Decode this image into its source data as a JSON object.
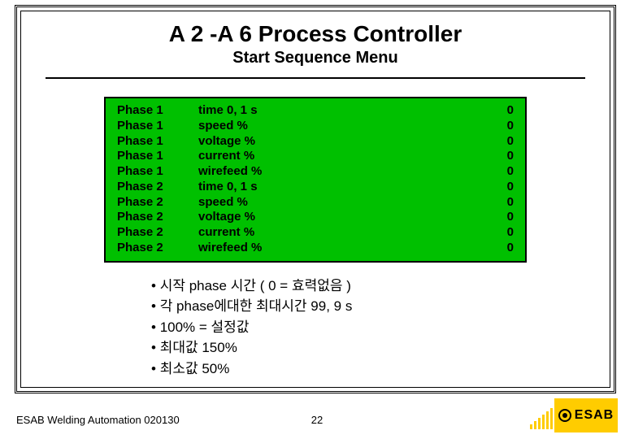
{
  "title": "A 2 -A 6 Process Controller",
  "subtitle": "Start Sequence Menu",
  "panel": {
    "rows": [
      {
        "phase": "Phase 1",
        "param": "time   0, 1 s",
        "value": "0"
      },
      {
        "phase": "Phase 1",
        "param": "speed  %",
        "value": "0"
      },
      {
        "phase": "Phase 1",
        "param": "voltage %",
        "value": "0"
      },
      {
        "phase": "Phase 1",
        "param": "current   %",
        "value": "0"
      },
      {
        "phase": "Phase 1",
        "param": "wirefeed  %",
        "value": "0"
      },
      {
        "phase": "Phase 2",
        "param": "time   0, 1 s",
        "value": "0"
      },
      {
        "phase": "Phase 2",
        "param": "speed  %",
        "value": "0"
      },
      {
        "phase": "Phase 2",
        "param": "voltage %",
        "value": "0"
      },
      {
        "phase": "Phase 2",
        "param": "current   %",
        "value": "0"
      },
      {
        "phase": "Phase 2",
        "param": "wirefeed  %",
        "value": "0"
      }
    ]
  },
  "bullets": [
    "시작 phase 시간 ( 0 = 효력없음  )",
    "각 phase에대한 최대시간 99, 9 s",
    "100% = 설정값",
    "최대값 150%",
    "최소값 50%"
  ],
  "footer": {
    "left": "ESAB Welding Automation 020130",
    "page": "22",
    "logo_text": "ESAB"
  }
}
